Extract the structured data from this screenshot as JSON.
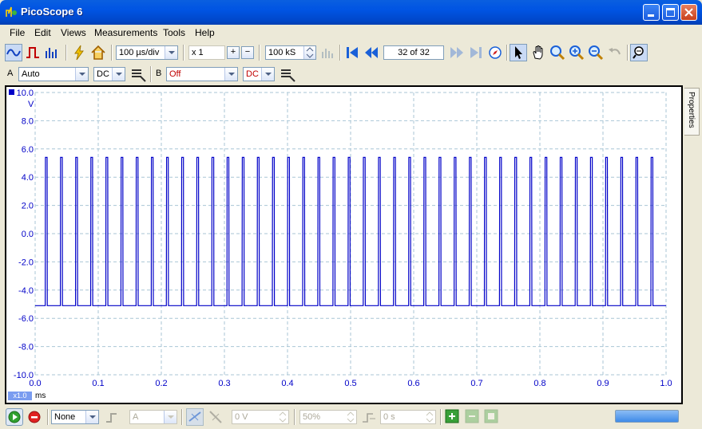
{
  "window": {
    "title": "PicoScope 6"
  },
  "menu": [
    {
      "label": "File"
    },
    {
      "label": "Edit"
    },
    {
      "label": "Views"
    },
    {
      "label": "Measurements"
    },
    {
      "label": "Tools"
    },
    {
      "label": "Help"
    }
  ],
  "toolbar": {
    "timebase": "100 µs/div",
    "multiplier": "x 1",
    "samples": "100 kS",
    "buffer_position": "32 of 32"
  },
  "channel_bar": {
    "a_label": "A",
    "a_range": "Auto",
    "a_coupling": "DC",
    "b_label": "B",
    "b_range": "Off",
    "b_coupling": "DC"
  },
  "scope": {
    "y_unit": "V",
    "x_unit": "ms",
    "zoom": "x1.0",
    "properties_tab": "Properties"
  },
  "trigger_bar": {
    "trigger_mode": "None",
    "trigger_channel": "A",
    "threshold": "0 V",
    "pre_trigger": "50%",
    "delay": "0 s"
  },
  "colors": {
    "trace": "#0000c8",
    "grid": "#a9c6d6",
    "axis_text": "#0000c8",
    "b_range_text": "#c00000"
  },
  "chart_data": {
    "type": "line",
    "xlim": [
      0.0,
      1.0
    ],
    "ylim": [
      -10.0,
      10.0
    ],
    "xticks": [
      "0.0",
      "0.1",
      "0.2",
      "0.3",
      "0.4",
      "0.5",
      "0.6",
      "0.7",
      "0.8",
      "0.9",
      "1.0"
    ],
    "yticks": [
      "10.0",
      "8.0",
      "6.0",
      "4.0",
      "2.0",
      "0.0",
      "-2.0",
      "-4.0",
      "-6.0",
      "-8.0",
      "-10.0"
    ],
    "grid": true,
    "low_level": -5.1,
    "high_level": 5.4,
    "pulse_starts_ms": [
      0.016,
      0.04,
      0.064,
      0.088,
      0.112,
      0.136,
      0.16,
      0.184,
      0.208,
      0.232,
      0.256,
      0.28,
      0.304,
      0.328,
      0.352,
      0.376,
      0.4,
      0.424,
      0.448,
      0.472,
      0.496,
      0.52,
      0.544,
      0.568,
      0.592,
      0.616,
      0.64,
      0.664,
      0.688,
      0.712,
      0.736,
      0.76,
      0.784,
      0.808,
      0.832,
      0.856,
      0.88,
      0.904,
      0.928,
      0.952,
      0.976
    ],
    "pulse_width_ms": 0.003
  }
}
